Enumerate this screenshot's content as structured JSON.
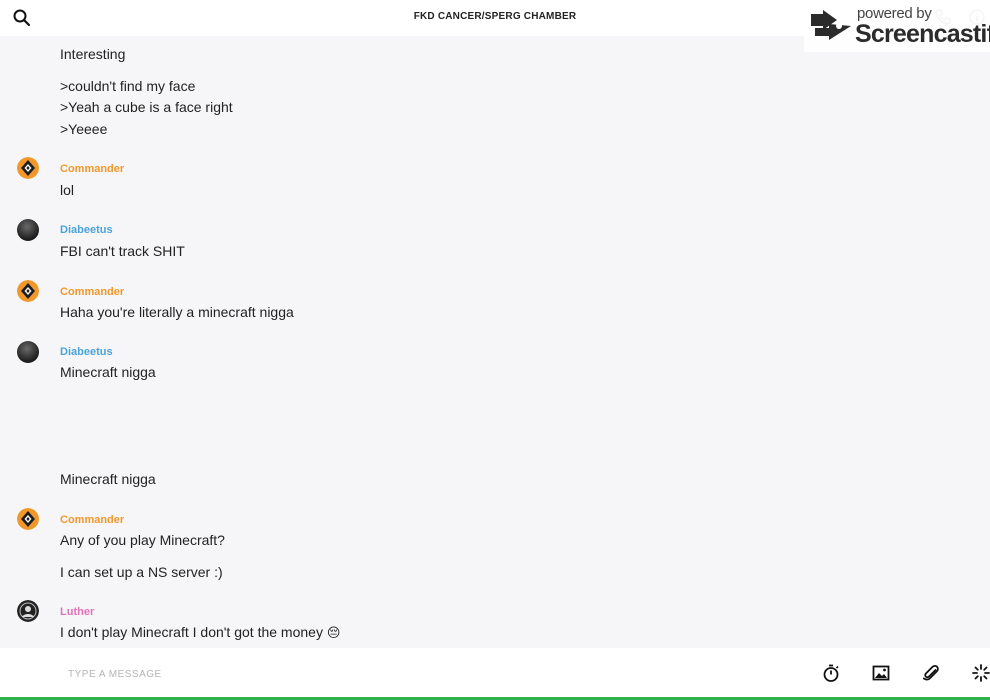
{
  "header": {
    "title": "FKD CANCER/SPERG CHAMBER",
    "search_icon": "search-icon",
    "call_icon": "phone-icon",
    "info_icon": "info-icon"
  },
  "watermark": {
    "powered": "powered by",
    "brand": "Screencastify"
  },
  "colors": {
    "commander": "#f0982a",
    "diabeetus": "#4aa3d9",
    "luther": "#e072b8"
  },
  "messages": [
    {
      "text": "Interesting"
    },
    {
      "text": ">couldn't find my face"
    },
    {
      "text": ">Yeah a cube is a face right"
    },
    {
      "text": ">Yeeee"
    },
    {
      "author": "Commander",
      "text": "lol"
    },
    {
      "author": "Diabeetus",
      "text": "FBI can't track SHIT"
    },
    {
      "author": "Commander",
      "text": "Haha you're literally a minecraft nigga"
    },
    {
      "author": "Diabeetus",
      "text": "Minecraft nigga"
    },
    {
      "text": "Minecraft nigga"
    },
    {
      "author": "Commander",
      "text": "Any of you play Minecraft?"
    },
    {
      "text": "I can set up a NS server :)"
    },
    {
      "author": "Luther",
      "text": "I don't play Minecraft I don't got the money",
      "emoji": "😔"
    }
  ],
  "composer": {
    "placeholder": "TYPE A MESSAGE",
    "icons": [
      "timer-icon",
      "image-icon",
      "paperclip-icon",
      "sparkle-icon"
    ]
  }
}
